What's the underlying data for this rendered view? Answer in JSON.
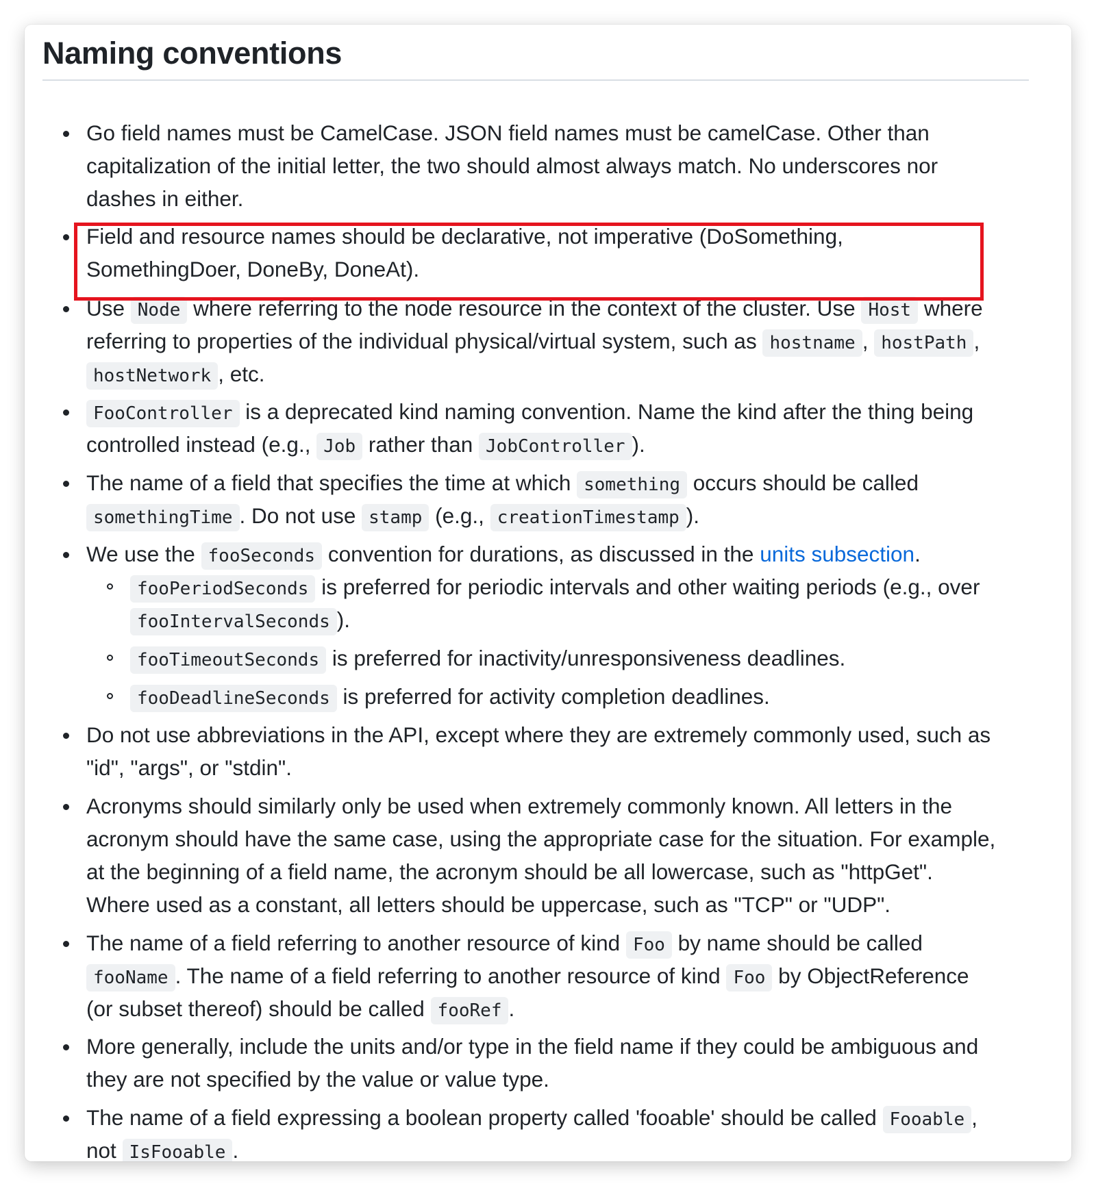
{
  "heading": "Naming conventions",
  "items": [
    {
      "lines": [
        "Go field names must be CamelCase. JSON field names must be camelCase. Other than",
        "capitalization of the initial letter, the two should almost always match. No underscores nor",
        "dashes in either."
      ]
    },
    {
      "lines": [
        "Field and resource names should be declarative, not imperative (DoSomething,",
        "SomethingDoer, DoneBy, DoneAt)."
      ]
    },
    {
      "segs": {
        "a": "Use ",
        "b": "Node",
        "c": " where referring to the node resource in the context of the cluster. Use ",
        "d": "Host",
        "e": " where",
        "f": "referring to properties of the individual physical/virtual system, such as ",
        "g": "hostname",
        "h": ", ",
        "i": "hostPath",
        "j": ",",
        "k": "hostNetwork",
        "l": ", etc."
      }
    },
    {
      "segs": {
        "a": "FooController",
        "b": " is a deprecated kind naming convention. Name the kind after the thing being",
        "c": "controlled instead (e.g., ",
        "d": "Job",
        "e": " rather than ",
        "f": "JobController",
        "g": ")."
      }
    },
    {
      "segs": {
        "a": "The name of a field that specifies the time at which ",
        "b": "something",
        "c": " occurs should be called",
        "d": "somethingTime",
        "e": ". Do not use ",
        "f": "stamp",
        "g": " (e.g., ",
        "h": "creationTimestamp",
        "i": ")."
      }
    },
    {
      "segs": {
        "a": "We use the ",
        "b": "fooSeconds",
        "c": " convention for durations, as discussed in the ",
        "link": "units subsection",
        "d": "."
      },
      "sub": [
        {
          "code": "fooPeriodSeconds",
          "text": " is preferred for periodic intervals and other waiting periods (e.g., over",
          "code2": "fooIntervalSeconds",
          "text2": ")."
        },
        {
          "code": "fooTimeoutSeconds",
          "text": " is preferred for inactivity/unresponsiveness deadlines."
        },
        {
          "code": "fooDeadlineSeconds",
          "text": " is preferred for activity completion deadlines."
        }
      ]
    },
    {
      "lines": [
        "Do not use abbreviations in the API, except where they are extremely commonly used, such as",
        "\"id\", \"args\", or \"stdin\"."
      ]
    },
    {
      "lines": [
        "Acronyms should similarly only be used when extremely commonly known. All letters in the",
        "acronym should have the same case, using the appropriate case for the situation. For example,",
        "at the beginning of a field name, the acronym should be all lowercase, such as \"httpGet\".",
        "Where used as a constant, all letters should be uppercase, such as \"TCP\" or \"UDP\"."
      ]
    },
    {
      "segs": {
        "a": "The name of a field referring to another resource of kind ",
        "b": "Foo",
        "c": " by name should be called",
        "d": "fooName",
        "e": ". The name of a field referring to another resource of kind ",
        "f": "Foo",
        "g": " by ObjectReference",
        "h": "(or subset thereof) should be called ",
        "i": "fooRef",
        "j": "."
      }
    },
    {
      "lines": [
        "More generally, include the units and/or type in the field name if they could be ambiguous and",
        "they are not specified by the value or value type."
      ]
    },
    {
      "segs": {
        "a": "The name of a field expressing a boolean property called 'fooable' should be called ",
        "b": "Fooable",
        "c": ",",
        "d": "not ",
        "e": "IsFooable",
        "f": "."
      }
    }
  ],
  "colors": {
    "highlight_border": "#e5141e",
    "link": "#0969da",
    "code_bg": "#eff1f3"
  }
}
